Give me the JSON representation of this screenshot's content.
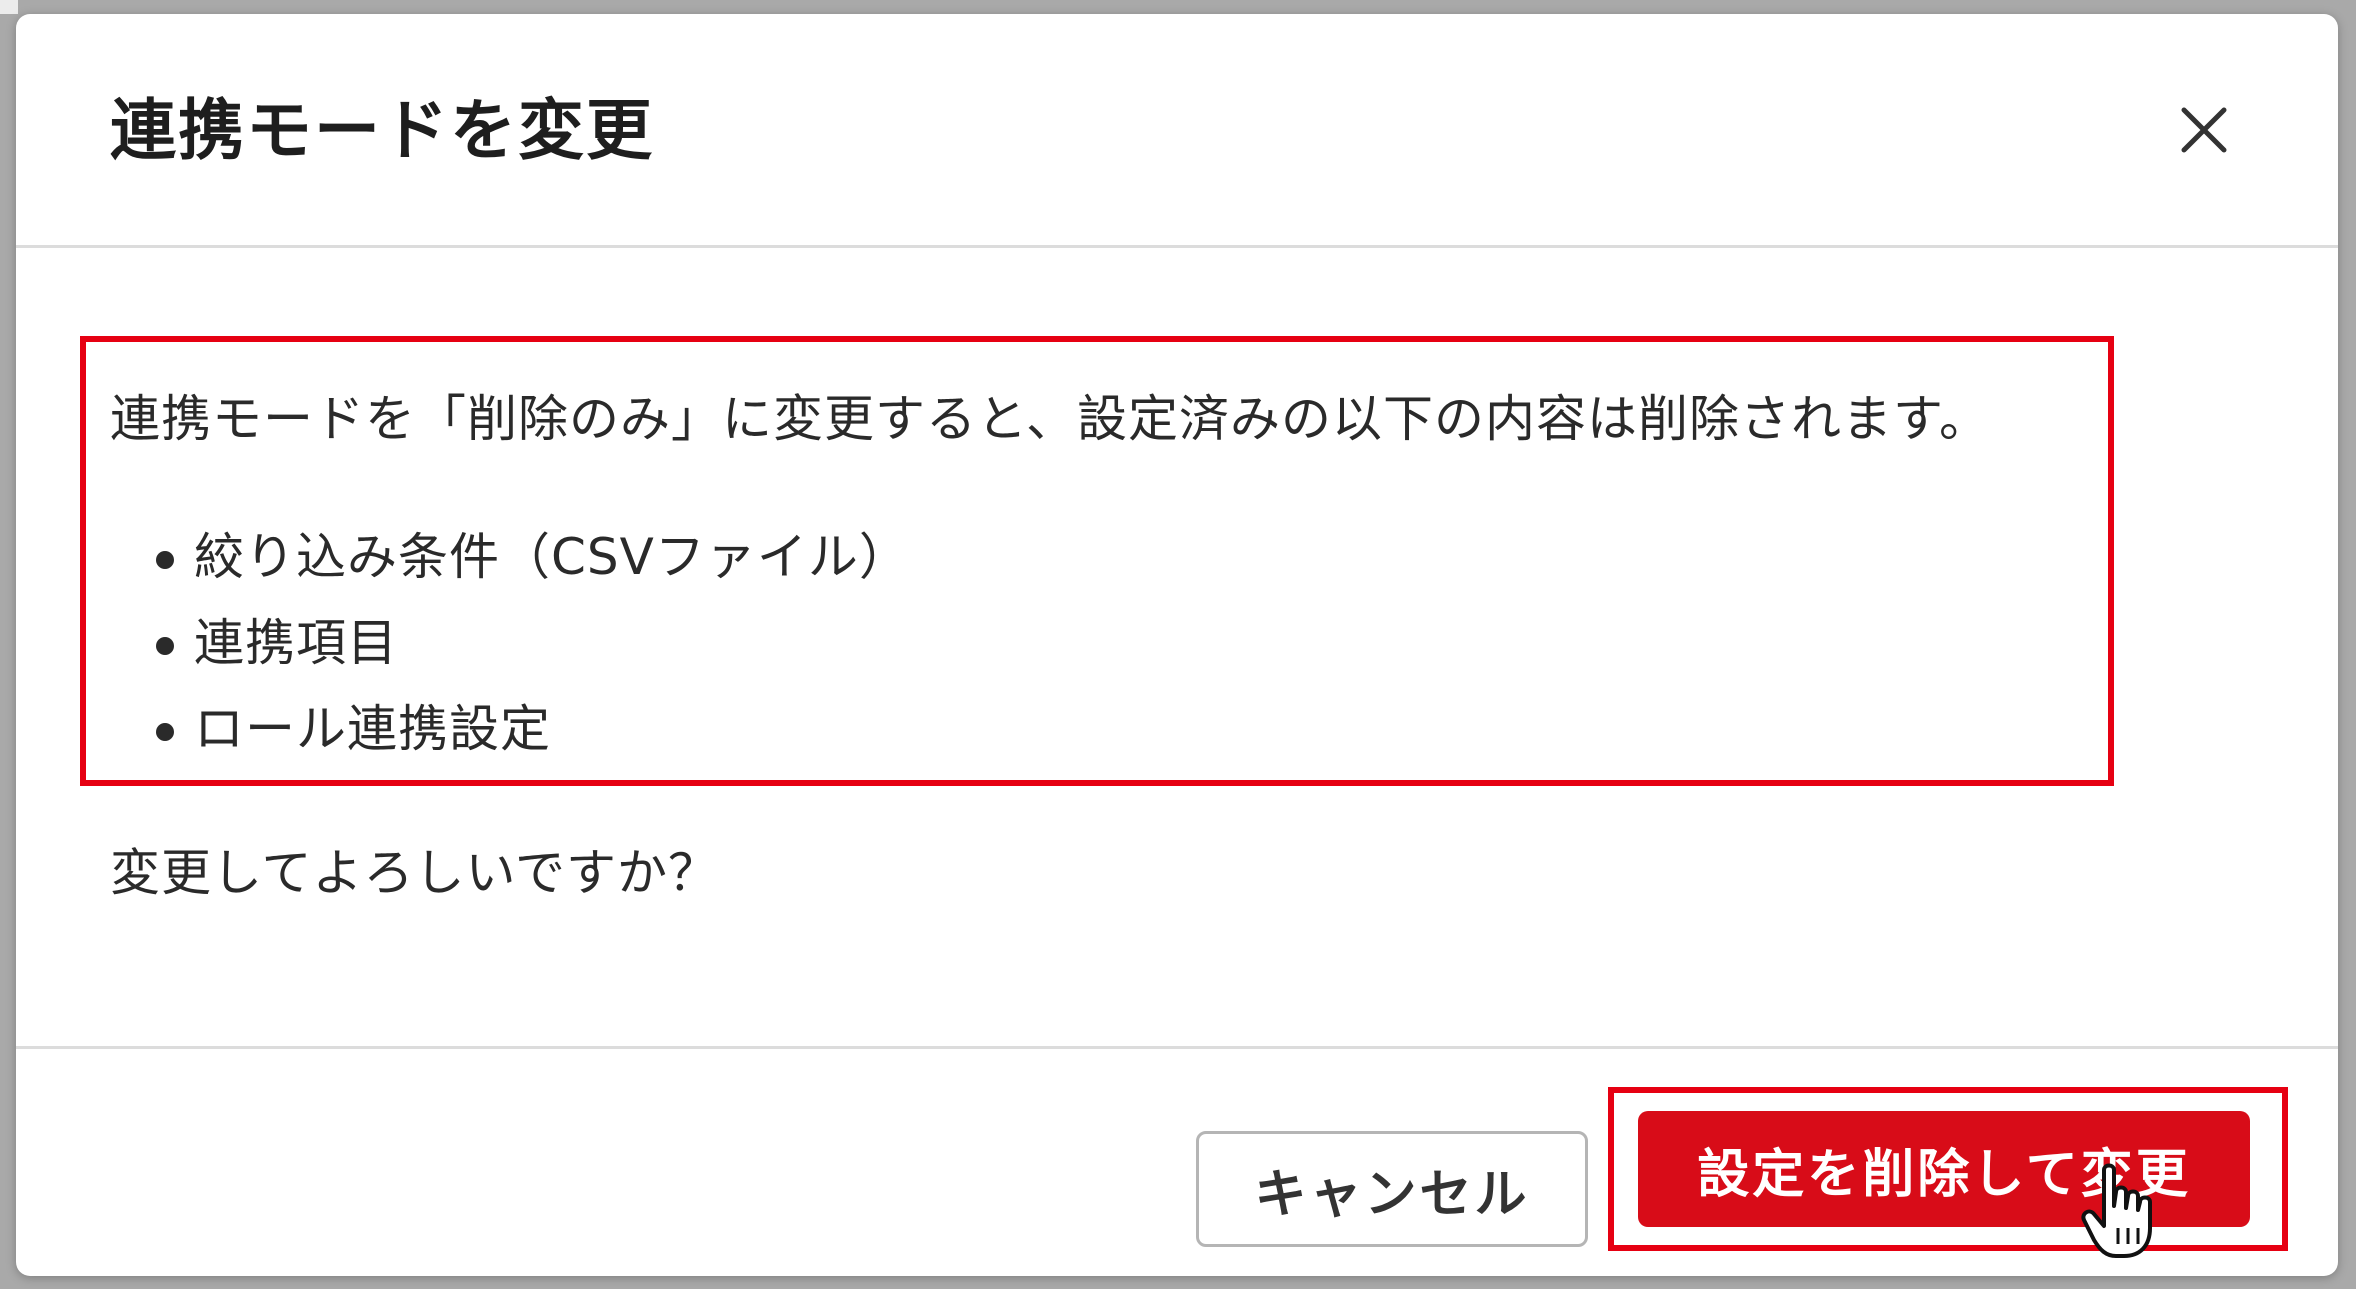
{
  "dialog": {
    "title": "連携モードを変更",
    "close_icon": "close-icon",
    "intro": "連携モードを「削除のみ」に変更すると、設定済みの以下の内容は削除されます。",
    "items": [
      "絞り込み条件（CSVファイル）",
      "連携項目",
      "ロール連携設定"
    ],
    "confirm": "変更してよろしいですか？",
    "cancel_label": "キャンセル",
    "submit_label": "設定を削除して変更"
  },
  "colors": {
    "highlight": "#e60012",
    "primary": "#d80c18",
    "border": "#dcdcdc"
  },
  "cursor_icon": "hand-pointer-icon"
}
